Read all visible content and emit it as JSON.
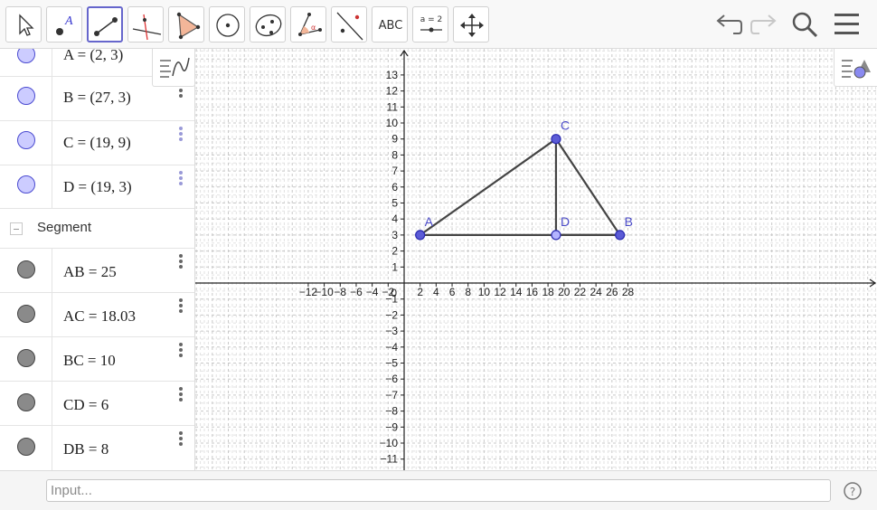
{
  "toolbar": {
    "tools": [
      {
        "name": "move-tool",
        "icon": "cursor-arrow-icon"
      },
      {
        "name": "point-tool",
        "icon": "point-icon",
        "label": "A"
      },
      {
        "name": "segment-tool",
        "icon": "segment-icon",
        "selected": true
      },
      {
        "name": "perpendicular-line-tool",
        "icon": "perpendicular-icon"
      },
      {
        "name": "polygon-tool",
        "icon": "polygon-icon"
      },
      {
        "name": "circle-tool",
        "icon": "circle-center-icon"
      },
      {
        "name": "ellipse-tool",
        "icon": "ellipse-icon"
      },
      {
        "name": "angle-tool",
        "icon": "angle-icon"
      },
      {
        "name": "reflect-tool",
        "icon": "reflect-line-icon"
      },
      {
        "name": "text-tool",
        "icon": "text-icon",
        "label": "ABC"
      },
      {
        "name": "slider-tool",
        "icon": "slider-icon",
        "label": "a = 2"
      },
      {
        "name": "move-graphics-tool",
        "icon": "move-graphics-icon"
      }
    ],
    "right_icons": [
      "undo-icon",
      "redo-icon",
      "search-icon",
      "menu-icon"
    ]
  },
  "algebra": {
    "points": [
      {
        "name": "A",
        "text": "A = (2, 3)"
      },
      {
        "name": "B",
        "text": "B = (27, 3)"
      },
      {
        "name": "C",
        "text": "C = (19, 9)"
      },
      {
        "name": "D",
        "text": "D = (19, 3)"
      }
    ],
    "group_label": "Segment",
    "segments": [
      {
        "name": "AB",
        "text": "AB = 25"
      },
      {
        "name": "AC",
        "text": "AC = 18.03"
      },
      {
        "name": "BC",
        "text": "BC = 10"
      },
      {
        "name": "CD",
        "text": "CD = 6"
      },
      {
        "name": "DB",
        "text": "DB = 8"
      }
    ]
  },
  "graph": {
    "x_ticks": [
      -12,
      -10,
      -8,
      -6,
      -4,
      -2,
      2,
      4,
      6,
      8,
      10,
      12,
      14,
      16,
      18,
      20,
      22,
      24,
      26,
      28
    ],
    "y_ticks": [
      -11,
      -10,
      -9,
      -8,
      -7,
      -6,
      -5,
      -4,
      -3,
      -2,
      -1,
      1,
      2,
      3,
      4,
      5,
      6,
      7,
      8,
      9,
      10,
      11,
      12,
      13
    ],
    "origin_label": "0",
    "points": [
      {
        "label": "A",
        "x": 2,
        "y": 3,
        "fill": "#5b5bd6"
      },
      {
        "label": "B",
        "x": 27,
        "y": 3,
        "fill": "#5b5bd6"
      },
      {
        "label": "C",
        "x": 19,
        "y": 9,
        "fill": "#5b5bd6"
      },
      {
        "label": "D",
        "x": 19,
        "y": 3,
        "fill": "#b3b3ff"
      }
    ],
    "segments": [
      [
        "A",
        "B"
      ],
      [
        "A",
        "C"
      ],
      [
        "B",
        "C"
      ],
      [
        "C",
        "D"
      ],
      [
        "D",
        "B"
      ]
    ],
    "colors": {
      "segment": "#444444",
      "point_stroke": "#2a2ab0",
      "point_label": "#4a4ac8",
      "grid_major": "#c8c8c8",
      "grid_minor": "#e2e2e2",
      "axis": "#222222"
    }
  },
  "input": {
    "placeholder": "Input..."
  }
}
